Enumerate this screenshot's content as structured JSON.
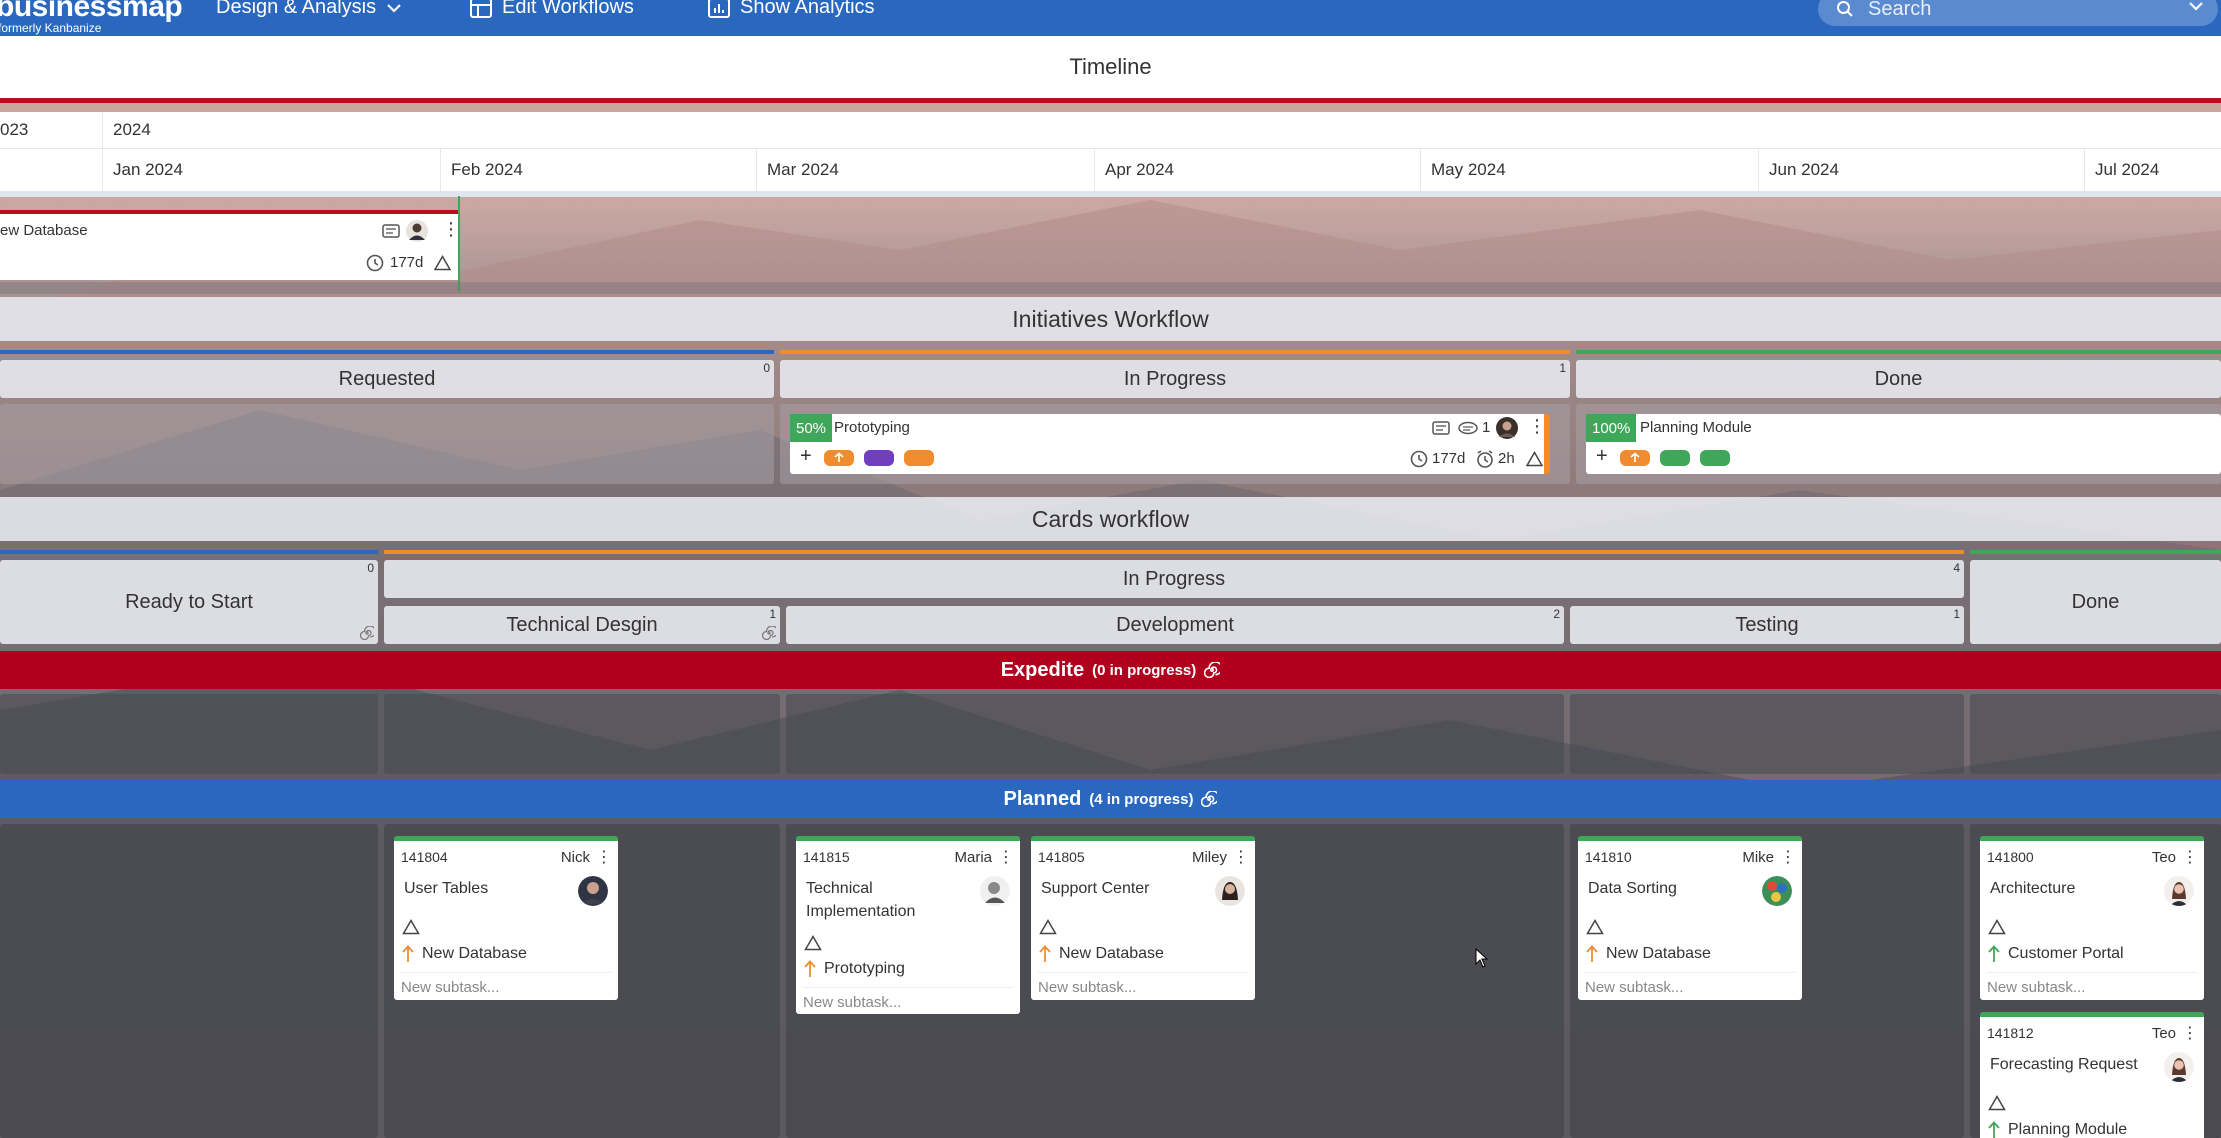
{
  "topbar": {
    "logo_main": "businessmap",
    "logo_sub": "formerly Kanbanize",
    "nav": [
      {
        "label": "Design & Analysis"
      },
      {
        "label": "Edit Workflows"
      },
      {
        "label": "Show Analytics"
      }
    ],
    "search_placeholder": "Search"
  },
  "timeline": {
    "title": "Timeline",
    "years": [
      "023",
      "2024"
    ],
    "months": [
      "Jan 2024",
      "Feb 2024",
      "Mar 2024",
      "Apr 2024",
      "May 2024",
      "Jun 2024",
      "Jul 2024"
    ],
    "card": {
      "title": "ew Database",
      "duration": "177d"
    }
  },
  "initiatives": {
    "title": "Initiatives Workflow",
    "columns": [
      {
        "name": "Requested",
        "count": "0"
      },
      {
        "name": "In Progress",
        "count": "1"
      },
      {
        "name": "Done",
        "count": ""
      }
    ],
    "cards": [
      {
        "percent": "50%",
        "title": "Prototyping",
        "comments": "1",
        "duration": "177d",
        "logged": "2h"
      },
      {
        "percent": "100%",
        "title": "Planning Module"
      }
    ]
  },
  "cards_workflow": {
    "title": "Cards workflow",
    "columns": {
      "ready": {
        "name": "Ready to Start",
        "count": "0"
      },
      "in_progress": {
        "name": "In Progress",
        "count": "4"
      },
      "technical": {
        "name": "Technical Desgin",
        "count": "1"
      },
      "development": {
        "name": "Development",
        "count": "2"
      },
      "testing": {
        "name": "Testing",
        "count": "1"
      },
      "done": {
        "name": "Done"
      }
    },
    "lanes": [
      {
        "name": "Expedite",
        "sub": "(0 in progress)"
      },
      {
        "name": "Planned",
        "sub": "(4 in progress)"
      }
    ],
    "cards": [
      {
        "id": "141804",
        "owner": "Nick",
        "title": "User Tables",
        "parent": "New Database",
        "subtask": "New subtask..."
      },
      {
        "id": "141815",
        "owner": "Maria",
        "title_l1": "Technical",
        "title_l2": "Implementation",
        "parent": "Prototyping",
        "subtask": "New subtask..."
      },
      {
        "id": "141805",
        "owner": "Miley",
        "title": "Support Center",
        "parent": "New Database",
        "subtask": "New subtask..."
      },
      {
        "id": "141810",
        "owner": "Mike",
        "title": "Data Sorting",
        "parent": "New Database",
        "subtask": "New subtask..."
      },
      {
        "id": "141800",
        "owner": "Teo",
        "title": "Architecture",
        "parent": "Customer Portal",
        "subtask": "New subtask..."
      },
      {
        "id": "141812",
        "owner": "Teo",
        "title": "Forecasting Request",
        "parent": "Planning Module"
      }
    ]
  },
  "colors": {
    "brand_blue": "#2a68c0",
    "expedite_red": "#b0001e",
    "progress_green": "#3fa75a",
    "orange": "#f08c2e",
    "purple": "#6f3fc0"
  }
}
